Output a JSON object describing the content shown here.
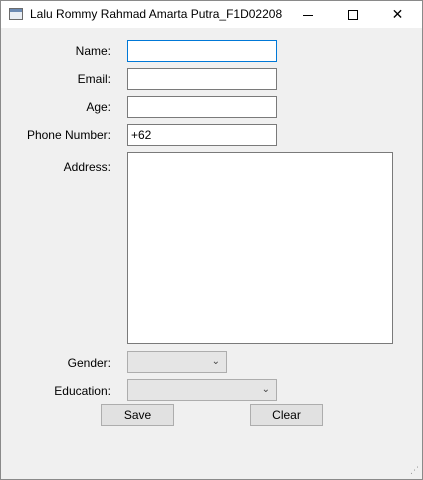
{
  "window": {
    "title": "Lalu Rommy Rahmad Amarta Putra_F1D02208",
    "controls": {
      "minimize": "minimize-icon",
      "maximize": "maximize-icon",
      "close": "close-icon"
    }
  },
  "form": {
    "name_label": "Name:",
    "name_value": "",
    "email_label": "Email:",
    "email_value": "",
    "age_label": "Age:",
    "age_value": "",
    "phone_label": "Phone Number:",
    "phone_value": "+62",
    "address_label": "Address:",
    "address_value": "",
    "gender_label": "Gender:",
    "gender_selected": "",
    "education_label": "Education:",
    "education_selected": ""
  },
  "buttons": {
    "save_label": "Save",
    "clear_label": "Clear"
  },
  "colors": {
    "window_bg": "#f0f0f0",
    "focus_border": "#0078d7"
  }
}
